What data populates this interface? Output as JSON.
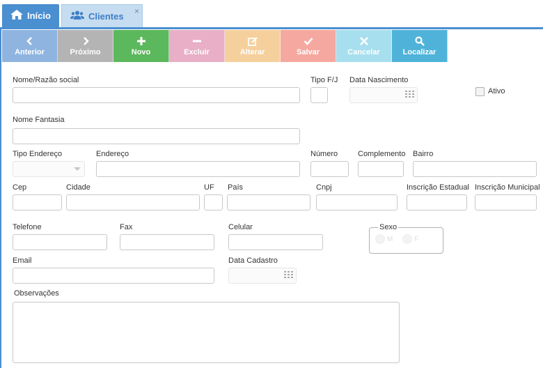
{
  "tabs": [
    {
      "label": "Início",
      "icon": "home-icon"
    },
    {
      "label": "Clientes",
      "icon": "users-icon",
      "close": "×"
    }
  ],
  "toolbar": {
    "anterior": "Anterior",
    "proximo": "Próximo",
    "novo": "Novo",
    "excluir": "Excluir",
    "alterar": "Alterar",
    "salvar": "Salvar",
    "cancelar": "Cancelar",
    "localizar": "Localizar"
  },
  "form": {
    "nome_razao_social": {
      "label": "Nome/Razão social",
      "value": ""
    },
    "tipo_fj": {
      "label": "Tipo F/J",
      "value": ""
    },
    "data_nascimento": {
      "label": "Data Nascimento",
      "value": ""
    },
    "ativo": {
      "label": "Ativo",
      "checked": false
    },
    "nome_fantasia": {
      "label": "Nome Fantasia",
      "value": ""
    },
    "tipo_endereco": {
      "label": "Tipo Endereço",
      "value": ""
    },
    "endereco": {
      "label": "Endereço",
      "value": ""
    },
    "numero": {
      "label": "Número",
      "value": ""
    },
    "complemento": {
      "label": "Complemento",
      "value": ""
    },
    "bairro": {
      "label": "Bairro",
      "value": ""
    },
    "cep": {
      "label": "Cep",
      "value": ""
    },
    "cidade": {
      "label": "Cidade",
      "value": ""
    },
    "uf": {
      "label": "UF",
      "value": ""
    },
    "pais": {
      "label": "País",
      "value": ""
    },
    "cnpj": {
      "label": "Cnpj",
      "value": ""
    },
    "inscricao_estadual": {
      "label": "Inscrição Estadual",
      "value": ""
    },
    "inscricao_municipal": {
      "label": "Inscrição Municipal",
      "value": ""
    },
    "telefone": {
      "label": "Telefone",
      "value": ""
    },
    "fax": {
      "label": "Fax",
      "value": ""
    },
    "celular": {
      "label": "Celular",
      "value": ""
    },
    "sexo": {
      "label": "Sexo",
      "options": [
        "M",
        "F"
      ]
    },
    "email": {
      "label": "Email",
      "value": ""
    },
    "data_cadastro": {
      "label": "Data Cadastro",
      "value": ""
    },
    "observacoes": {
      "label": "Observações",
      "value": ""
    }
  },
  "colors": {
    "accent": "#4a8fd0",
    "novo": "#5cb85c",
    "localizar": "#4fb3d9"
  }
}
